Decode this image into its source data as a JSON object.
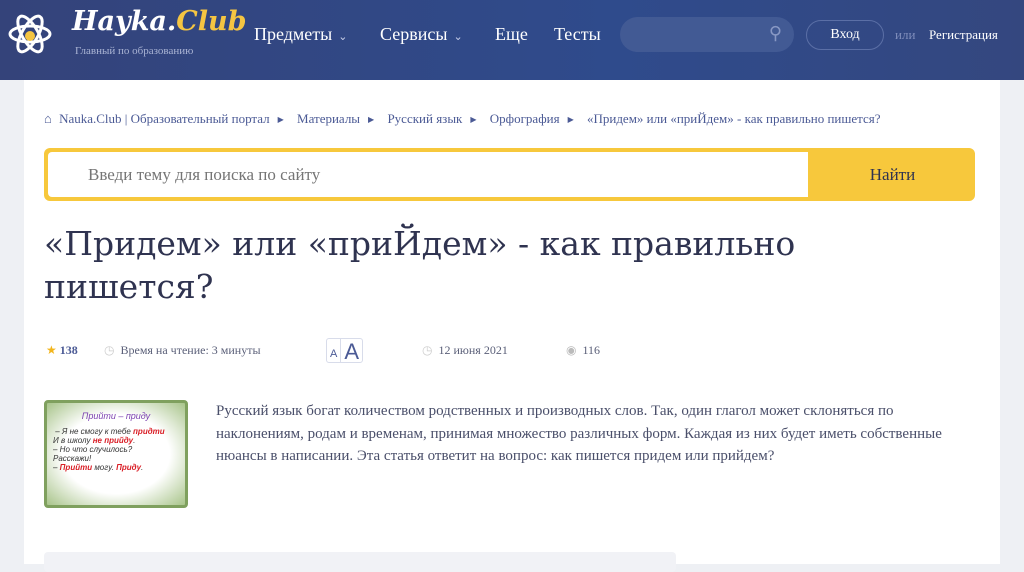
{
  "header": {
    "logo_main": "Hayka.",
    "logo_accent": "Club",
    "tagline": "Главный по образованию",
    "nav": [
      "Предметы",
      "Сервисы",
      "Еще",
      "Тесты"
    ],
    "login": "Вход",
    "or": "или",
    "register": "Регистрация"
  },
  "breadcrumbs": [
    "Nauka.Club | Образовательный портал",
    "Материалы",
    "Русский язык",
    "Орфография",
    "«Придем» или «приЙдем» - как правильно пишется?"
  ],
  "search": {
    "placeholder": "Введи тему для поиска по сайту",
    "button": "Найти"
  },
  "article": {
    "title": "«Придем» или «приЙдем» - как правильно пишется?",
    "rating": "138",
    "reading_time": "Время на чтение: 3 минуты",
    "font_small": "A",
    "font_large": "A",
    "date": "12 июня 2021",
    "views": "116",
    "image": {
      "title": "Прийти – приду",
      "l1a": "– Я не смогу к тебе ",
      "l1b": "придти",
      "l2a": "И в школу ",
      "l2b": "не прийду",
      "l3": "– Но что случилось?",
      "l4": "Расскажи!",
      "l5a": "– ",
      "l5b": "Прийти",
      "l5c": " могу. ",
      "l5d": "Приду"
    },
    "intro": "Русский язык богат количеством родственных и производных слов. Так, один глагол может склоняться по наклонениям, родам и временам, принимая множество различных форм. Каждая из них будет иметь собственные нюансы в написании. Эта статья ответит на вопрос: как пишется придем или прийдем?"
  }
}
